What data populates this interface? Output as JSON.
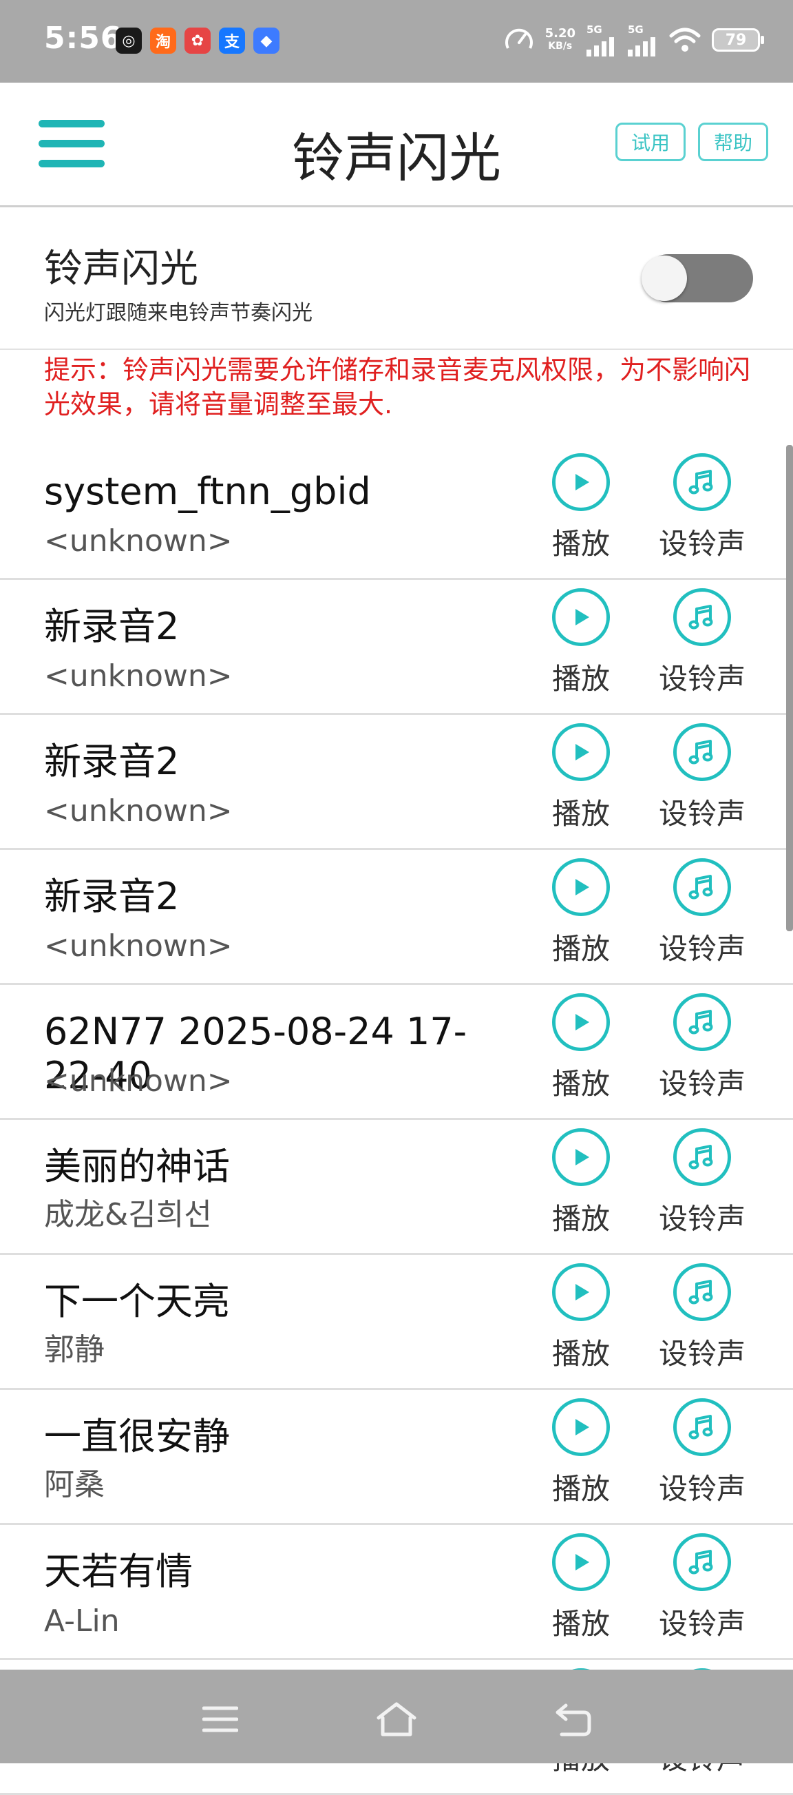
{
  "status_bar": {
    "time": "5:56",
    "app_icons": [
      {
        "name": "target-app-icon",
        "bg": "#1a1a1a",
        "glyph": "◎"
      },
      {
        "name": "taobao-app-icon",
        "bg": "#ff6a1a",
        "glyph": "淘"
      },
      {
        "name": "game-app-icon",
        "bg": "#e64545",
        "glyph": "✿"
      },
      {
        "name": "alipay-app-icon",
        "bg": "#1677ff",
        "glyph": "支"
      },
      {
        "name": "browser-app-icon",
        "bg": "#3d7bff",
        "glyph": "◆"
      }
    ],
    "net_speed_value": "5.20",
    "net_speed_unit": "KB/s",
    "signal1": "5G",
    "signal2": "5G",
    "battery": "79"
  },
  "appbar": {
    "title": "铃声闪光",
    "try_label": "试用",
    "help_label": "帮助"
  },
  "toggle": {
    "title": "铃声闪光",
    "subtitle": "闪光灯跟随来电铃声节奏闪光",
    "enabled": false
  },
  "hint": "提示：铃声闪光需要允许储存和录音麦克风权限，为不影响闪光效果，请将音量调整至最大.",
  "actions": {
    "play_label": "播放",
    "ringtone_label": "设铃声"
  },
  "songs": [
    {
      "title": "system_ftnn_gbid",
      "artist": "<unknown>"
    },
    {
      "title": "新录音2",
      "artist": "<unknown>"
    },
    {
      "title": "新录音2",
      "artist": "<unknown>"
    },
    {
      "title": "新录音2",
      "artist": "<unknown>"
    },
    {
      "title": "62N77 2025-08-24 17-22-40",
      "artist": "<unknown>"
    },
    {
      "title": "美丽的神话",
      "artist": "成龙&김희선"
    },
    {
      "title": "下一个天亮",
      "artist": "郭静"
    },
    {
      "title": "一直很安静",
      "artist": "阿桑"
    },
    {
      "title": "天若有情",
      "artist": "A-Lin"
    },
    {
      "title": "",
      "artist": ""
    }
  ],
  "colors": {
    "accent": "#21bfbf",
    "hint": "#e02020",
    "status_bar": "#a9a9a9"
  }
}
